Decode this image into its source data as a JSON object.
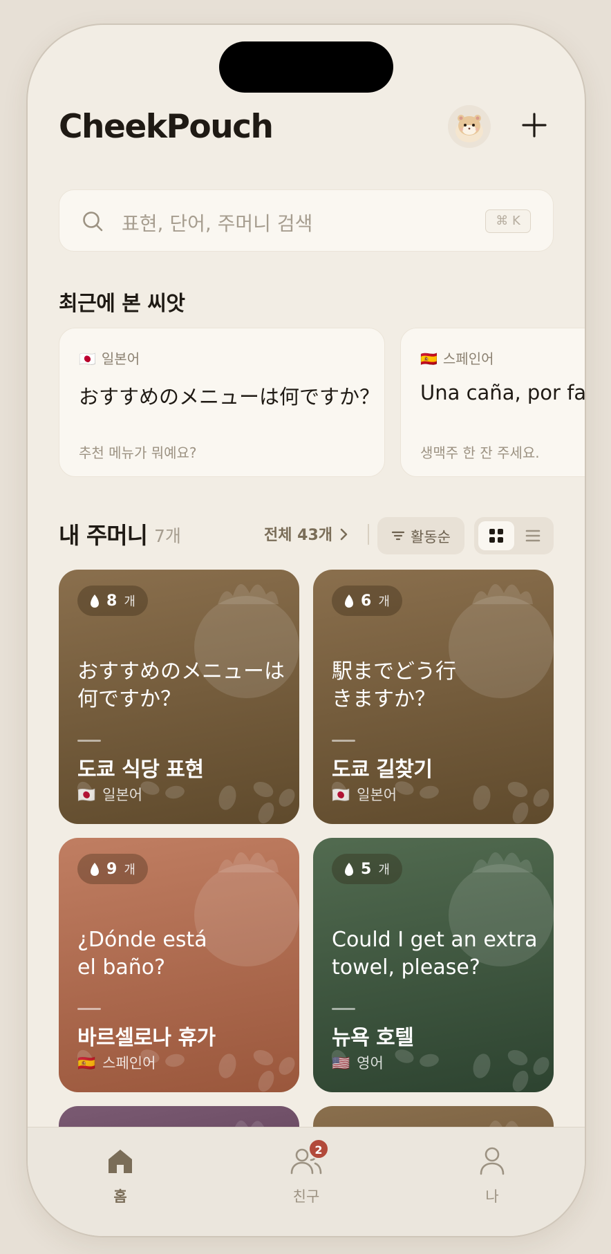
{
  "app": {
    "title": "CheekPouch"
  },
  "search": {
    "placeholder": "표현, 단어, 주머니 검색",
    "shortcut": "⌘ K"
  },
  "recent": {
    "title": "최근에 본 씨앗",
    "items": [
      {
        "flag": "🇯🇵",
        "language": "일본어",
        "phrase": "おすすめのメニューは何ですか？",
        "translation": "추천 메뉴가 뭐예요?"
      },
      {
        "flag": "🇪🇸",
        "language": "스페인어",
        "phrase": "Una caña, por favor.",
        "translation": "생맥주 한 잔 주세요."
      }
    ]
  },
  "pouches": {
    "title": "내 주머니",
    "count_label": "7개",
    "view_all_label": "전체 43개",
    "sort_label": "활동순",
    "view_mode": "grid",
    "items": [
      {
        "seed_count": "8",
        "seed_unit": "개",
        "phrase": "おすすめのメニューは何ですか？",
        "title": "도쿄 식당 표현",
        "flag": "🇯🇵",
        "language": "일본어",
        "color": "#7a6142"
      },
      {
        "seed_count": "6",
        "seed_unit": "개",
        "phrase": "駅までどう行きますか？",
        "title": "도쿄 길찾기",
        "flag": "🇯🇵",
        "language": "일본어",
        "color": "#7a6142"
      },
      {
        "seed_count": "9",
        "seed_unit": "개",
        "phrase": "¿Dónde está el baño?",
        "title": "바르셀로나 휴가",
        "flag": "🇪🇸",
        "language": "스페인어",
        "color": "#ad6a50"
      },
      {
        "seed_count": "5",
        "seed_unit": "개",
        "phrase": "Could I get an extra towel, please?",
        "title": "뉴욕 호텔",
        "flag": "🇺🇸",
        "language": "영어",
        "color": "#3e5a3e"
      }
    ]
  },
  "tabbar": {
    "items": [
      {
        "label": "홈",
        "icon": "home-icon",
        "active": true
      },
      {
        "label": "친구",
        "icon": "friends-icon",
        "active": false,
        "badge": "2"
      },
      {
        "label": "나",
        "icon": "profile-icon",
        "active": false
      }
    ]
  }
}
